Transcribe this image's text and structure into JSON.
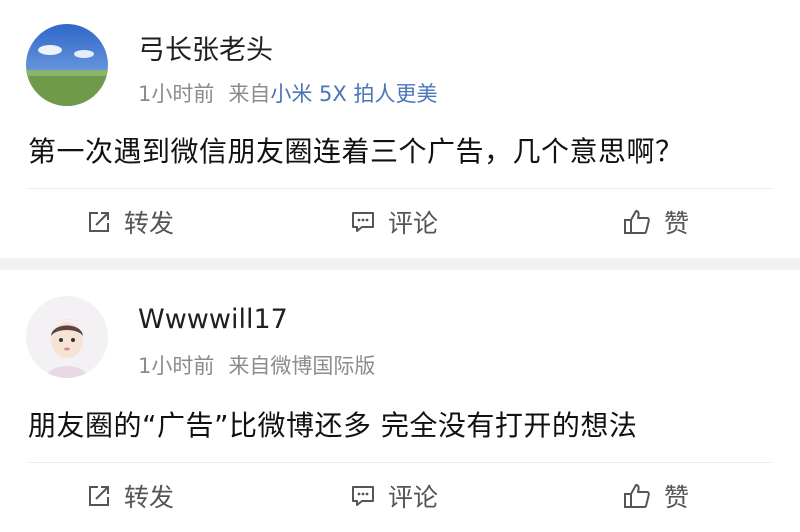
{
  "posts": [
    {
      "username": "弓长张老头",
      "time": "1小时前",
      "source_prefix": "来自",
      "device": "小米 5X 拍人更美",
      "text": "第一次遇到微信朋友圈连着三个广告，几个意思啊？",
      "actions": {
        "forward": "转发",
        "comment": "评论",
        "like": "赞"
      }
    },
    {
      "username": "Wwwwill17",
      "time": "1小时前",
      "source_prefix": "来自",
      "device": "微博国际版",
      "text": "朋友圈的“广告”比微博还多   完全没有打开的想法",
      "actions": {
        "forward": "转发",
        "comment": "评论",
        "like": "赞"
      }
    }
  ],
  "colors": {
    "device_link": "#4a76b8",
    "meta_gray": "#8c8c8c",
    "divider": "#f1f1f1"
  },
  "icons": [
    "forward-icon",
    "comment-icon",
    "like-icon"
  ]
}
